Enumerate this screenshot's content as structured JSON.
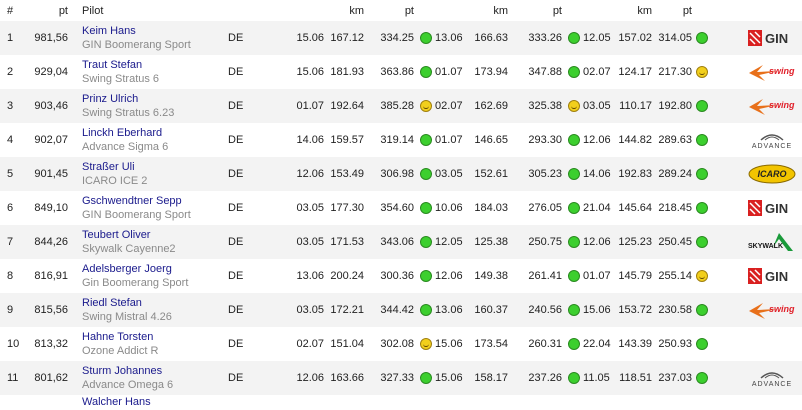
{
  "headers": {
    "rank": "#",
    "pt": "pt",
    "pilot": "Pilot",
    "km1": "km",
    "pt1": "pt",
    "km2": "km",
    "pt2": "pt",
    "km3": "km",
    "pt3": "pt"
  },
  "rows": [
    {
      "rank": "1",
      "pts": "981,56",
      "name": "Keim Hans",
      "glider": "GIN Boomerang Sport",
      "nation": "DE",
      "d1": "15.06",
      "km1": "167.12",
      "p1": "334.25",
      "s1": "ok",
      "d2": "13.06",
      "km2": "166.63",
      "p2": "333.26",
      "s2": "ok",
      "d3": "12.05",
      "km3": "157.02",
      "p3": "314.05",
      "s3": "ok",
      "logo": "gin-logo"
    },
    {
      "rank": "2",
      "pts": "929,04",
      "name": "Traut Stefan",
      "glider": "Swing Stratus 6",
      "nation": "DE",
      "d1": "15.06",
      "km1": "181.93",
      "p1": "363.86",
      "s1": "ok",
      "d2": "01.07",
      "km2": "173.94",
      "p2": "347.88",
      "s2": "ok",
      "d3": "02.07",
      "km3": "124.17",
      "p3": "217.30",
      "s3": "smile",
      "logo": "swing-logo"
    },
    {
      "rank": "3",
      "pts": "903,46",
      "name": "Prinz Ulrich",
      "glider": "Swing Stratus 6.23",
      "nation": "DE",
      "d1": "01.07",
      "km1": "192.64",
      "p1": "385.28",
      "s1": "smile",
      "d2": "02.07",
      "km2": "162.69",
      "p2": "325.38",
      "s2": "smile",
      "d3": "03.05",
      "km3": "110.17",
      "p3": "192.80",
      "s3": "ok",
      "logo": "swing-logo"
    },
    {
      "rank": "4",
      "pts": "902,07",
      "name": "Linckh Eberhard",
      "glider": "Advance Sigma 6",
      "nation": "DE",
      "d1": "14.06",
      "km1": "159.57",
      "p1": "319.14",
      "s1": "ok",
      "d2": "01.07",
      "km2": "146.65",
      "p2": "293.30",
      "s2": "ok",
      "d3": "12.06",
      "km3": "144.82",
      "p3": "289.63",
      "s3": "ok",
      "logo": "advance-logo"
    },
    {
      "rank": "5",
      "pts": "901,45",
      "name": "Straßer Uli",
      "glider": "ICARO ICE 2",
      "nation": "DE",
      "d1": "12.06",
      "km1": "153.49",
      "p1": "306.98",
      "s1": "ok",
      "d2": "03.05",
      "km2": "152.61",
      "p2": "305.23",
      "s2": "ok",
      "d3": "14.06",
      "km3": "192.83",
      "p3": "289.24",
      "s3": "ok",
      "logo": "icaro-logo"
    },
    {
      "rank": "6",
      "pts": "849,10",
      "name": "Gschwendtner Sepp",
      "glider": "GIN Boomerang Sport",
      "nation": "DE",
      "d1": "03.05",
      "km1": "177.30",
      "p1": "354.60",
      "s1": "ok",
      "d2": "10.06",
      "km2": "184.03",
      "p2": "276.05",
      "s2": "ok",
      "d3": "21.04",
      "km3": "145.64",
      "p3": "218.45",
      "s3": "ok",
      "logo": "gin-logo"
    },
    {
      "rank": "7",
      "pts": "844,26",
      "name": "Teubert Oliver",
      "glider": "Skywalk Cayenne2",
      "nation": "DE",
      "d1": "03.05",
      "km1": "171.53",
      "p1": "343.06",
      "s1": "ok",
      "d2": "12.05",
      "km2": "125.38",
      "p2": "250.75",
      "s2": "ok",
      "d3": "12.06",
      "km3": "125.23",
      "p3": "250.45",
      "s3": "ok",
      "logo": "skywalk-logo"
    },
    {
      "rank": "8",
      "pts": "816,91",
      "name": "Adelsberger Joerg",
      "glider": "Gin Boomerang Sport",
      "nation": "DE",
      "d1": "13.06",
      "km1": "200.24",
      "p1": "300.36",
      "s1": "ok",
      "d2": "12.06",
      "km2": "149.38",
      "p2": "261.41",
      "s2": "ok",
      "d3": "01.07",
      "km3": "145.79",
      "p3": "255.14",
      "s3": "smile",
      "logo": "gin-logo"
    },
    {
      "rank": "9",
      "pts": "815,56",
      "name": "Riedl Stefan",
      "glider": "Swing Mistral 4.26",
      "nation": "DE",
      "d1": "03.05",
      "km1": "172.21",
      "p1": "344.42",
      "s1": "ok",
      "d2": "13.06",
      "km2": "160.37",
      "p2": "240.56",
      "s2": "ok",
      "d3": "15.06",
      "km3": "153.72",
      "p3": "230.58",
      "s3": "ok",
      "logo": "swing-logo"
    },
    {
      "rank": "10",
      "pts": "813,32",
      "name": "Hahne Torsten",
      "glider": "Ozone Addict R",
      "nation": "DE",
      "d1": "02.07",
      "km1": "151.04",
      "p1": "302.08",
      "s1": "smile",
      "d2": "15.06",
      "km2": "173.54",
      "p2": "260.31",
      "s2": "ok",
      "d3": "22.04",
      "km3": "143.39",
      "p3": "250.93",
      "s3": "ok",
      "logo": ""
    },
    {
      "rank": "11",
      "pts": "801,62",
      "name": "Sturm Johannes",
      "glider": "Advance Omega 6",
      "nation": "DE",
      "d1": "12.06",
      "km1": "163.66",
      "p1": "327.33",
      "s1": "ok",
      "d2": "15.06",
      "km2": "158.17",
      "p2": "237.26",
      "s2": "ok",
      "d3": "11.05",
      "km3": "118.51",
      "p3": "237.03",
      "s3": "ok",
      "logo": "advance-logo"
    }
  ],
  "partial_row": {
    "name": "Walcher Hans"
  },
  "logos": {
    "gin": "GIN",
    "swing": "swing",
    "advance": "ADVANCE",
    "icaro": "ICARO",
    "skywalk": "SKYWALK"
  },
  "colors": {
    "ok": "#3ccf2e",
    "smile": "#f2cf1c",
    "link": "#1a1a8c",
    "zebra": "#f3f3f3"
  }
}
